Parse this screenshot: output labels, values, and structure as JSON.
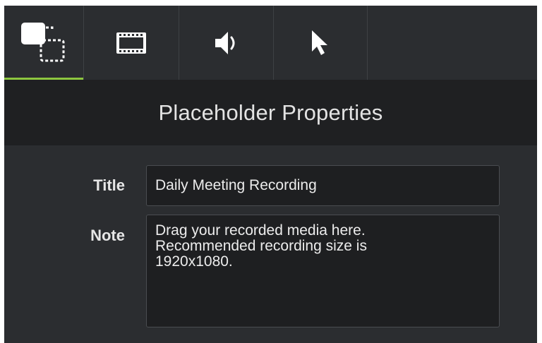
{
  "tabs": [
    {
      "id": "visual-properties",
      "icon": "placeholder-media-icon",
      "active": true
    },
    {
      "id": "video-properties",
      "icon": "film-strip-icon",
      "active": false
    },
    {
      "id": "audio-properties",
      "icon": "speaker-icon",
      "active": false
    },
    {
      "id": "cursor-properties",
      "icon": "cursor-arrow-icon",
      "active": false
    }
  ],
  "header": {
    "title": "Placeholder Properties"
  },
  "form": {
    "title_label": "Title",
    "title_value": "Daily Meeting Recording",
    "note_label": "Note",
    "note_value": "Drag your recorded media here.\nRecommended recording size is\n1920x1080."
  },
  "colors": {
    "panel_bg": "#2b2d30",
    "header_bg": "#1f2022",
    "active_tab_accent": "#8dc63f"
  }
}
